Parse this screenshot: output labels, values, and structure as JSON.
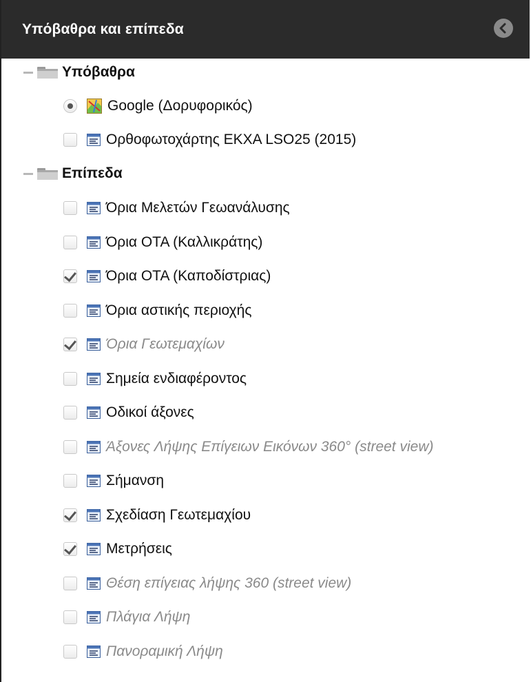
{
  "header": {
    "title": "Υπόβαθρα και επίπεδα",
    "collapse_icon": "chevron-left-circle-icon"
  },
  "groups": [
    {
      "label": "Υπόβαθρα",
      "items": [
        {
          "label": "Google (Δορυφορικός)",
          "control": "radio",
          "checked": true,
          "icon": "map-icon",
          "dim": false
        },
        {
          "label": "Ορθοφωτοχάρτης ΕΚΧΑ LSO25 (2015)",
          "control": "checkbox",
          "checked": false,
          "icon": "layer-icon",
          "dim": false
        }
      ]
    },
    {
      "label": "Επίπεδα",
      "items": [
        {
          "label": "Όρια Μελετών Γεωανάλυσης",
          "control": "checkbox",
          "checked": false,
          "icon": "layer-icon",
          "dim": false
        },
        {
          "label": "Όρια ΟΤΑ (Καλλικράτης)",
          "control": "checkbox",
          "checked": false,
          "icon": "layer-icon",
          "dim": false
        },
        {
          "label": "Όρια ΟΤΑ (Καποδίστριας)",
          "control": "checkbox",
          "checked": true,
          "icon": "layer-icon",
          "dim": false
        },
        {
          "label": "Όρια αστικής περιοχής",
          "control": "checkbox",
          "checked": false,
          "icon": "layer-icon",
          "dim": false
        },
        {
          "label": "Όρια Γεωτεμαχίων",
          "control": "checkbox",
          "checked": true,
          "icon": "layer-icon",
          "dim": true
        },
        {
          "label": "Σημεία ενδιαφέροντος",
          "control": "checkbox",
          "checked": false,
          "icon": "layer-icon",
          "dim": false
        },
        {
          "label": "Οδικοί άξονες",
          "control": "checkbox",
          "checked": false,
          "icon": "layer-icon",
          "dim": false
        },
        {
          "label": "Άξονες Λήψης Επίγειων Εικόνων 360° (street view)",
          "control": "checkbox",
          "checked": false,
          "icon": "layer-icon",
          "dim": true
        },
        {
          "label": "Σήμανση",
          "control": "checkbox",
          "checked": false,
          "icon": "layer-icon",
          "dim": false
        },
        {
          "label": "Σχεδίαση Γεωτεμαχίου",
          "control": "checkbox",
          "checked": true,
          "icon": "layer-icon",
          "dim": false
        },
        {
          "label": "Μετρήσεις",
          "control": "checkbox",
          "checked": true,
          "icon": "layer-icon",
          "dim": false
        },
        {
          "label": "Θέση επίγειας λήψης 360 (street view)",
          "control": "checkbox",
          "checked": false,
          "icon": "layer-icon",
          "dim": true
        },
        {
          "label": "Πλάγια Λήψη",
          "control": "checkbox",
          "checked": false,
          "icon": "layer-icon",
          "dim": true
        },
        {
          "label": "Πανοραμική Λήψη",
          "control": "checkbox",
          "checked": false,
          "icon": "layer-icon",
          "dim": true
        }
      ]
    }
  ]
}
